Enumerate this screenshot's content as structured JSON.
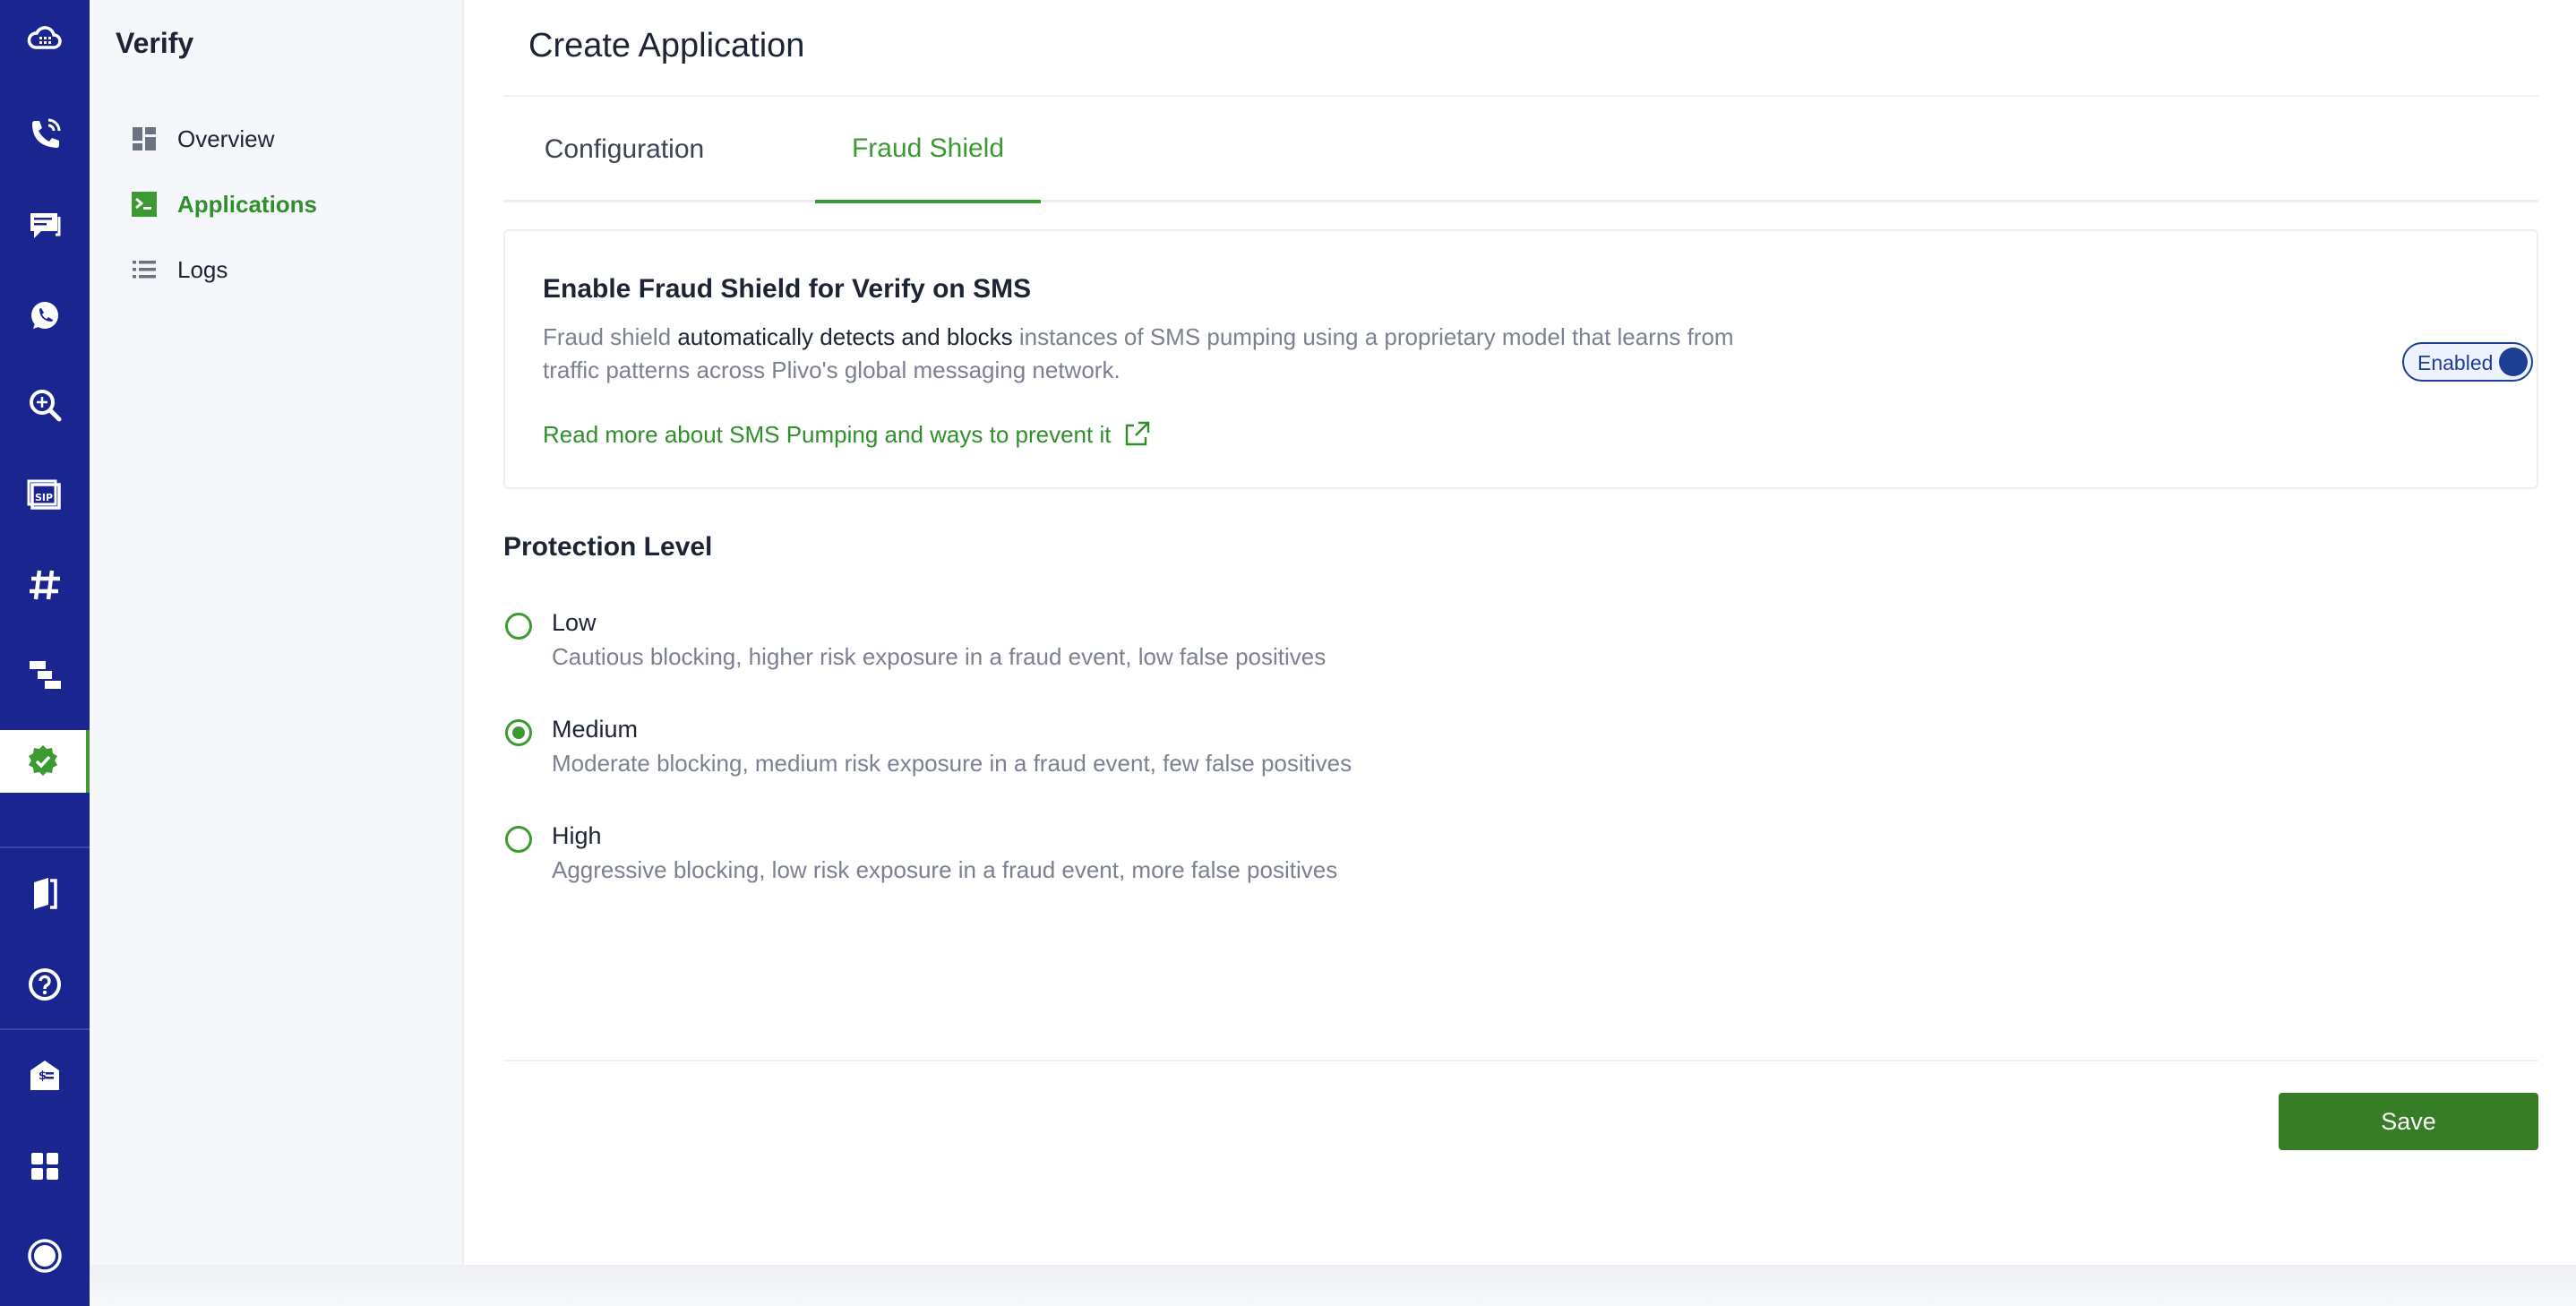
{
  "rail": {
    "items": [
      {
        "name": "cloud-dashboard-icon"
      },
      {
        "name": "voice-call-icon"
      },
      {
        "name": "messaging-icon"
      },
      {
        "name": "whatsapp-icon"
      },
      {
        "name": "number-lookup-icon"
      },
      {
        "name": "sip-trunking-icon"
      },
      {
        "name": "phone-numbers-icon"
      },
      {
        "name": "workflow-icon"
      },
      {
        "name": "verify-icon",
        "active": true
      },
      {
        "name": "docs-icon"
      },
      {
        "name": "help-icon"
      },
      {
        "name": "billing-icon"
      },
      {
        "name": "apps-grid-icon"
      },
      {
        "name": "account-icon"
      }
    ]
  },
  "subnav": {
    "title": "Verify",
    "items": [
      {
        "label": "Overview",
        "icon": "dashboard-icon"
      },
      {
        "label": "Applications",
        "icon": "terminal-icon",
        "active": true
      },
      {
        "label": "Logs",
        "icon": "list-icon"
      }
    ]
  },
  "main": {
    "title": "Create Application",
    "tabs": [
      {
        "label": "Configuration"
      },
      {
        "label": "Fraud Shield",
        "active": true
      }
    ],
    "fraud_shield": {
      "title": "Enable Fraud Shield for Verify on SMS",
      "desc_part1": "Fraud shield ",
      "desc_strong": "automatically detects and blocks",
      "desc_part2": " instances of SMS pumping using a proprietary model that learns from traffic patterns across Plivo's global messaging network.",
      "link_text": "Read more about SMS Pumping and ways to prevent it",
      "toggle_label": "Enabled",
      "enabled": true
    },
    "protection": {
      "title": "Protection Level",
      "selected": "Medium",
      "options": [
        {
          "label": "Low",
          "desc": "Cautious blocking, higher risk exposure in a fraud event, low false positives"
        },
        {
          "label": "Medium",
          "desc": "Moderate blocking, medium risk exposure in a fraud event, few false positives"
        },
        {
          "label": "High",
          "desc": "Aggressive blocking, low risk exposure in a fraud event, more false positives"
        }
      ]
    },
    "save_label": "Save"
  },
  "colors": {
    "rail_bg": "#1a2590",
    "accent_green": "#3c9a32",
    "save_green": "#377d27",
    "toggle_blue": "#1c3f93"
  }
}
